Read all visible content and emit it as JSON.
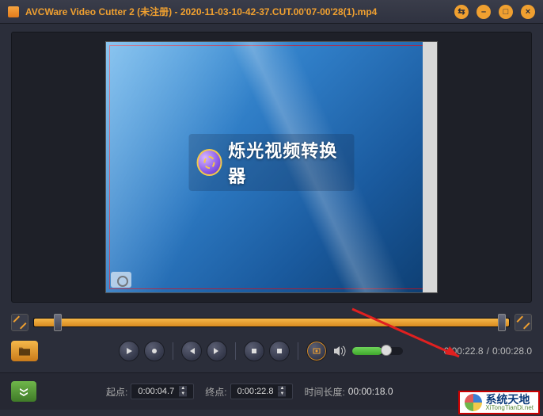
{
  "titlebar": {
    "app_name": "AVCWare Video Cutter 2 (未注册)",
    "file_name": "2020-11-03-10-42-37.CUT.00'07-00'28(1).mp4",
    "separator": " - "
  },
  "video_overlay": {
    "text": "烁光视频转换器"
  },
  "playback": {
    "current": "0:00:22.8",
    "total": "0:00:28.0",
    "separator": " / "
  },
  "cut_fields": {
    "start_label": "起点:",
    "start_value": "0:00:04.7",
    "end_label": "终点:",
    "end_value": "0:00:22.8",
    "duration_label": "时间长度:",
    "duration_value": "00:00:18.0"
  },
  "watermark": {
    "cn": "系统天地",
    "en": "XiTongTianDi.net"
  },
  "icons": {
    "play": "play",
    "record": "record",
    "prev": "prev",
    "next": "next",
    "stop": "stop",
    "stop_alt": "stop",
    "snapshot": "snapshot",
    "volume": "volume"
  }
}
